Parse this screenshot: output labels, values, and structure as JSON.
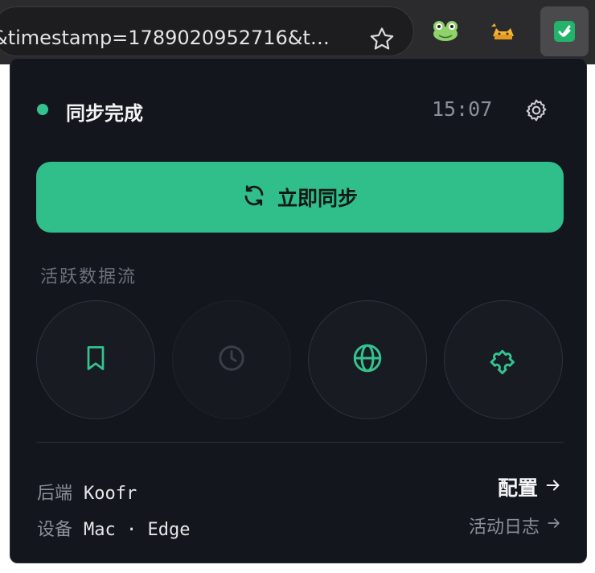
{
  "browser": {
    "url_text": "&timestamp=1789020952716&t…",
    "extensions": [
      "frog-extension",
      "cat-extension",
      "sync-extension"
    ]
  },
  "popup": {
    "status": "同步完成",
    "status_color": "#34c38f",
    "time": "15:07",
    "sync_button_label": "立即同步",
    "accent": "#30be8a",
    "section_label": "活跃数据流",
    "streams": [
      {
        "icon": "bookmark-icon",
        "active": true
      },
      {
        "icon": "history-clock-icon",
        "active": false
      },
      {
        "icon": "globe-icon",
        "active": true
      },
      {
        "icon": "puzzle-icon",
        "active": true
      }
    ],
    "backend_label": "后端",
    "backend_value": "Koofr",
    "device_label": "设备",
    "device_value": "Mac · Edge",
    "config_link": "配置",
    "log_link": "活动日志"
  }
}
